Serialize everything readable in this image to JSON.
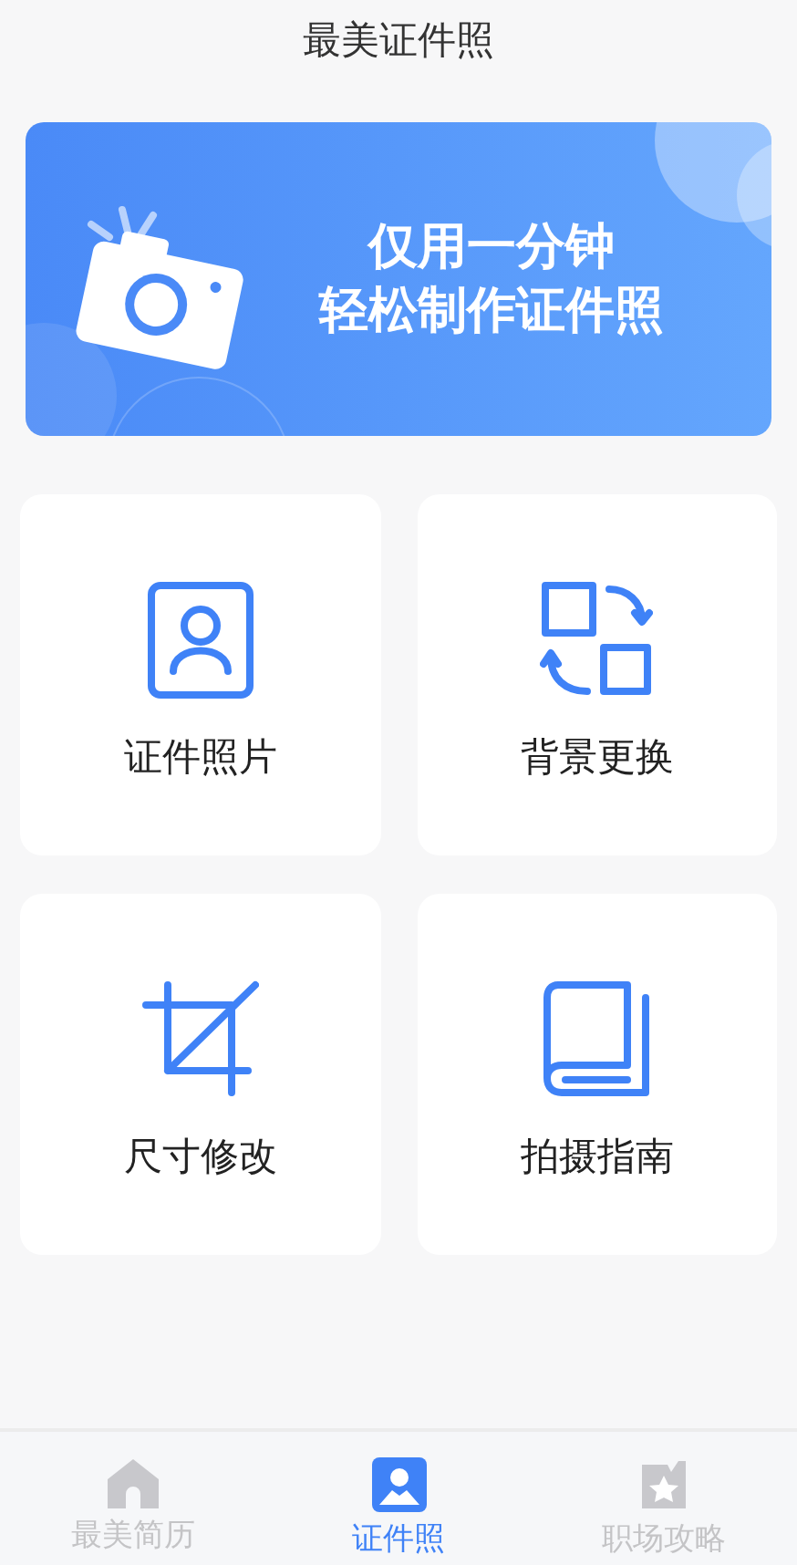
{
  "header": {
    "title": "最美证件照"
  },
  "banner": {
    "line_1": "仅用一分钟",
    "line_2": "轻松制作证件照"
  },
  "features": [
    {
      "kind": "portrait",
      "label": "证件照片"
    },
    {
      "kind": "swap",
      "label": "背景更换"
    },
    {
      "kind": "crop",
      "label": "尺寸修改"
    },
    {
      "kind": "book",
      "label": "拍摄指南"
    }
  ],
  "tab_bar": [
    {
      "kind": "home",
      "label": "最美简历",
      "selected": false
    },
    {
      "kind": "photo",
      "label": "证件照",
      "selected": true
    },
    {
      "kind": "star",
      "label": "职场攻略",
      "selected": false
    }
  ]
}
